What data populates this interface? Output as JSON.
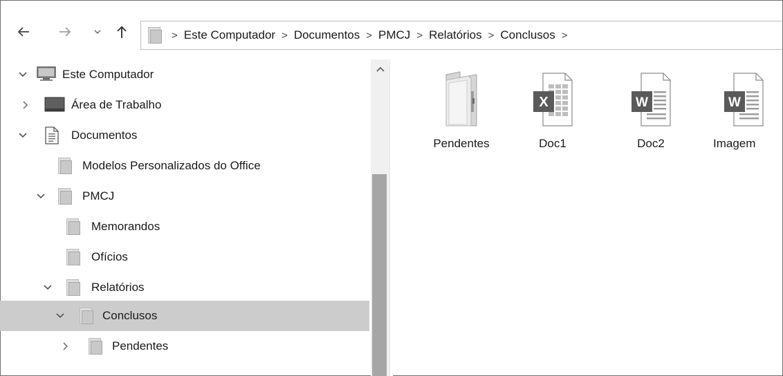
{
  "toolbar": {
    "back_icon": "arrow-left-icon",
    "forward_icon": "arrow-right-icon",
    "recent_icon": "chevron-down-icon",
    "up_icon": "arrow-up-icon",
    "breadcrumbs": [
      "Este Computador",
      "Documentos",
      "PMCJ",
      "Relatórios",
      "Conclusos"
    ]
  },
  "tree": {
    "items": [
      {
        "label": "Este Computador",
        "icon": "computer-icon",
        "expanded": true
      },
      {
        "label": "Área de Trabalho",
        "icon": "desktop-icon",
        "expanded": false
      },
      {
        "label": "Documentos",
        "icon": "documents-icon",
        "expanded": true
      },
      {
        "label": "Modelos Personalizados do Office",
        "icon": "folder-icon"
      },
      {
        "label": "PMCJ",
        "icon": "folder-icon",
        "expanded": true
      },
      {
        "label": "Memorandos",
        "icon": "folder-icon"
      },
      {
        "label": "Ofícios",
        "icon": "folder-icon"
      },
      {
        "label": "Relatórios",
        "icon": "folder-icon",
        "expanded": true
      },
      {
        "label": "Conclusos",
        "icon": "folder-icon",
        "expanded": true,
        "selected": true
      },
      {
        "label": "Pendentes",
        "icon": "folder-icon",
        "expanded": false
      }
    ]
  },
  "files": [
    {
      "name": "Pendentes",
      "icon": "folder-icon"
    },
    {
      "name": "Doc1",
      "icon": "excel-icon"
    },
    {
      "name": "Doc2",
      "icon": "word-icon"
    },
    {
      "name": "Imagem",
      "icon": "word-icon"
    }
  ],
  "colors": {
    "selected_bg": "#cccccc",
    "scroll_thumb": "#a6a6a6"
  }
}
